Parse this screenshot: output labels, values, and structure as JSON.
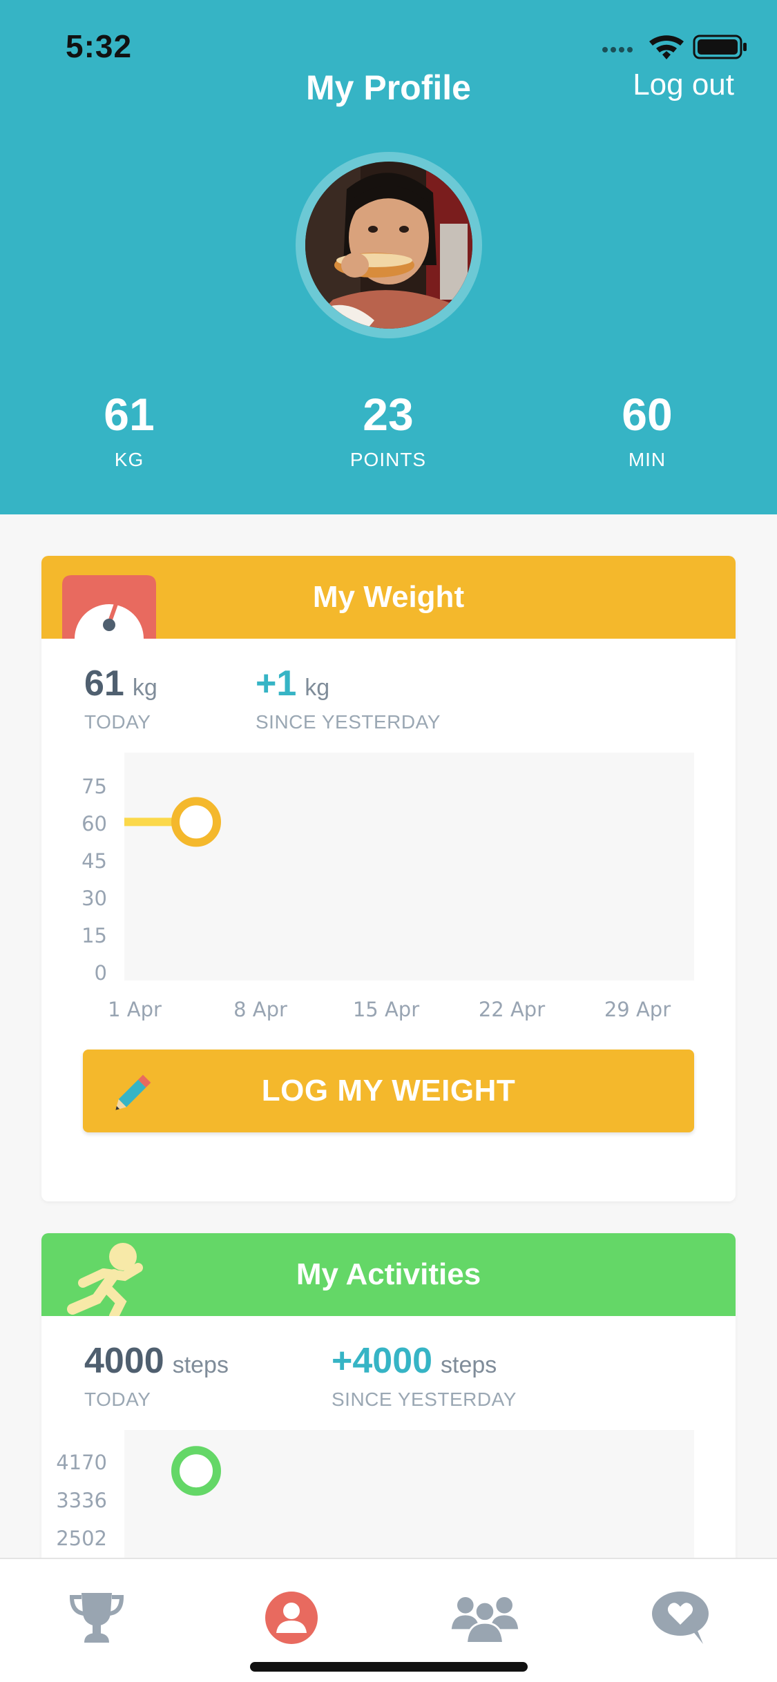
{
  "status_bar": {
    "time": "5:32"
  },
  "header": {
    "title": "My Profile",
    "logout_label": "Log out",
    "stats": [
      {
        "value": "61",
        "unit": "KG"
      },
      {
        "value": "23",
        "unit": "POINTS"
      },
      {
        "value": "60",
        "unit": "MIN"
      }
    ]
  },
  "weight_card": {
    "title": "My Weight",
    "today_value": "61",
    "today_unit": "kg",
    "today_label": "TODAY",
    "change_value": "+1",
    "change_unit": "kg",
    "change_label": "SINCE YESTERDAY",
    "button_label": "LOG MY WEIGHT"
  },
  "activity_card": {
    "title": "My Activities",
    "today_value": "4000",
    "today_unit": "steps",
    "today_label": "TODAY",
    "change_value": "+4000",
    "change_unit": "steps",
    "change_label": "SINCE YESTERDAY"
  },
  "chart_data": [
    {
      "type": "line",
      "y_ticks": [
        "75",
        "60",
        "45",
        "30",
        "15",
        "0"
      ],
      "x_ticks": [
        "1 Apr",
        "8 Apr",
        "15 Apr",
        "22 Apr",
        "29 Apr"
      ],
      "ylim": [
        0,
        75
      ],
      "series": [
        {
          "values": [
            61
          ],
          "color": "#f4b82c"
        }
      ],
      "grid": false
    },
    {
      "type": "line",
      "y_ticks": [
        "4170",
        "3336",
        "2502"
      ],
      "series": [
        {
          "values": [
            4000
          ],
          "color": "#64d767"
        }
      ],
      "grid": false
    }
  ],
  "colors": {
    "header_bg": "#36b4c5",
    "weight_accent": "#f4b82c",
    "activity_accent": "#64d767",
    "gauge_red": "#e86a5f"
  },
  "tabs": [
    {
      "icon": "trophy-icon"
    },
    {
      "icon": "profile-icon",
      "active": true
    },
    {
      "icon": "group-icon"
    },
    {
      "icon": "chat-heart-icon"
    }
  ]
}
